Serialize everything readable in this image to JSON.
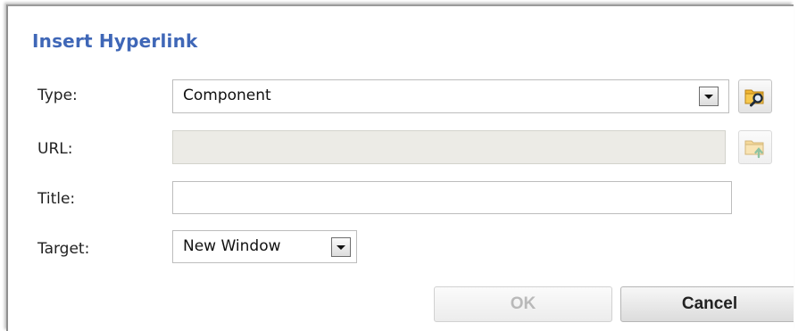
{
  "dialog": {
    "title": "Insert Hyperlink",
    "type_label": "Type:",
    "type_value": "Component",
    "url_label": "URL:",
    "url_value": "",
    "title_label": "Title:",
    "title_value": "",
    "target_label": "Target:",
    "target_value": "New Window",
    "ok_label": "OK",
    "cancel_label": "Cancel"
  },
  "icons": {
    "browse": "folder-search-icon",
    "upload": "folder-upload-icon",
    "dropdown": "chevron-down-icon"
  },
  "colors": {
    "title": "#3f67b7",
    "disabled_field": "#ecebe6",
    "folder": "#f2b632"
  }
}
